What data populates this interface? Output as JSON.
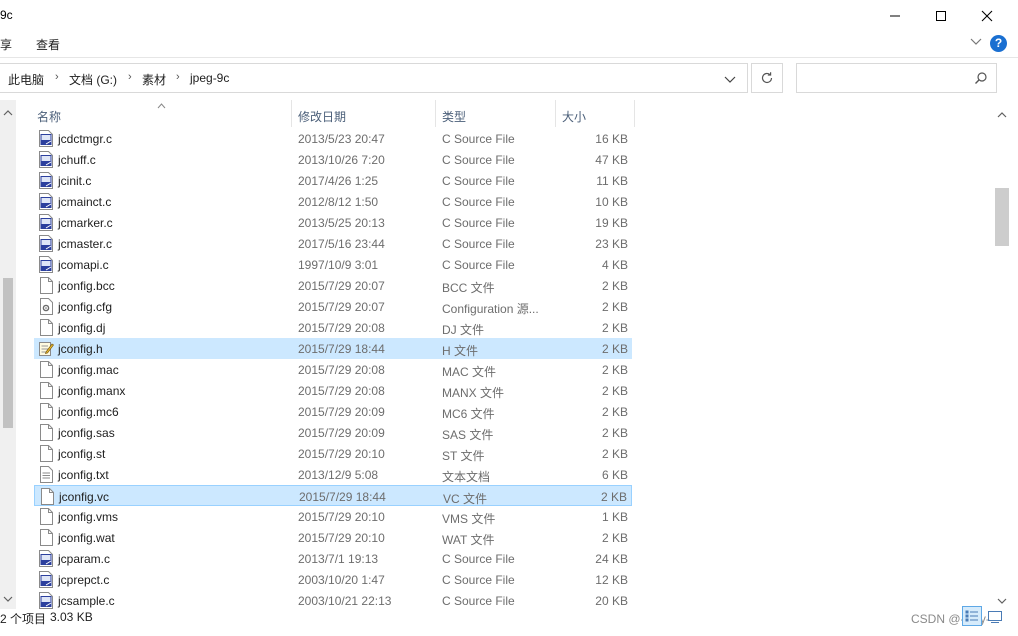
{
  "window": {
    "title": "9c"
  },
  "ribbon": {
    "tab_share": "享",
    "tab_view": "查看"
  },
  "address": {
    "crumbs": [
      "此电脑",
      "文档 (G:)",
      "素材",
      "jpeg-9c"
    ],
    "separator": "›"
  },
  "search": {
    "placeholder": ""
  },
  "columns": {
    "name": "名称",
    "date": "修改日期",
    "type": "类型",
    "size": "大小"
  },
  "files": [
    {
      "name": "jcdctmgr.c",
      "date": "2013/5/23 20:47",
      "type": "C Source File",
      "size": "16 KB",
      "icon": "c-source-file-icon",
      "state": ""
    },
    {
      "name": "jchuff.c",
      "date": "2013/10/26 7:20",
      "type": "C Source File",
      "size": "47 KB",
      "icon": "c-source-file-icon",
      "state": ""
    },
    {
      "name": "jcinit.c",
      "date": "2017/4/26 1:25",
      "type": "C Source File",
      "size": "11 KB",
      "icon": "c-source-file-icon",
      "state": ""
    },
    {
      "name": "jcmainct.c",
      "date": "2012/8/12 1:50",
      "type": "C Source File",
      "size": "10 KB",
      "icon": "c-source-file-icon",
      "state": ""
    },
    {
      "name": "jcmarker.c",
      "date": "2013/5/25 20:13",
      "type": "C Source File",
      "size": "19 KB",
      "icon": "c-source-file-icon",
      "state": ""
    },
    {
      "name": "jcmaster.c",
      "date": "2017/5/16 23:44",
      "type": "C Source File",
      "size": "23 KB",
      "icon": "c-source-file-icon",
      "state": ""
    },
    {
      "name": "jcomapi.c",
      "date": "1997/10/9 3:01",
      "type": "C Source File",
      "size": "4 KB",
      "icon": "c-source-file-icon",
      "state": ""
    },
    {
      "name": "jconfig.bcc",
      "date": "2015/7/29 20:07",
      "type": "BCC 文件",
      "size": "2 KB",
      "icon": "blank-file-icon",
      "state": ""
    },
    {
      "name": "jconfig.cfg",
      "date": "2015/7/29 20:07",
      "type": "Configuration 源...",
      "size": "2 KB",
      "icon": "config-file-icon",
      "state": ""
    },
    {
      "name": "jconfig.dj",
      "date": "2015/7/29 20:08",
      "type": "DJ 文件",
      "size": "2 KB",
      "icon": "blank-file-icon",
      "state": ""
    },
    {
      "name": "jconfig.h",
      "date": "2015/7/29 18:44",
      "type": "H 文件",
      "size": "2 KB",
      "icon": "header-file-icon",
      "state": "selected"
    },
    {
      "name": "jconfig.mac",
      "date": "2015/7/29 20:08",
      "type": "MAC 文件",
      "size": "2 KB",
      "icon": "blank-file-icon",
      "state": ""
    },
    {
      "name": "jconfig.manx",
      "date": "2015/7/29 20:08",
      "type": "MANX 文件",
      "size": "2 KB",
      "icon": "blank-file-icon",
      "state": ""
    },
    {
      "name": "jconfig.mc6",
      "date": "2015/7/29 20:09",
      "type": "MC6 文件",
      "size": "2 KB",
      "icon": "blank-file-icon",
      "state": ""
    },
    {
      "name": "jconfig.sas",
      "date": "2015/7/29 20:09",
      "type": "SAS 文件",
      "size": "2 KB",
      "icon": "blank-file-icon",
      "state": ""
    },
    {
      "name": "jconfig.st",
      "date": "2015/7/29 20:10",
      "type": "ST 文件",
      "size": "2 KB",
      "icon": "blank-file-icon",
      "state": ""
    },
    {
      "name": "jconfig.txt",
      "date": "2013/12/9 5:08",
      "type": "文本文档",
      "size": "6 KB",
      "icon": "text-file-icon",
      "state": ""
    },
    {
      "name": "jconfig.vc",
      "date": "2015/7/29 18:44",
      "type": "VC 文件",
      "size": "2 KB",
      "icon": "blank-file-icon",
      "state": "focused"
    },
    {
      "name": "jconfig.vms",
      "date": "2015/7/29 20:10",
      "type": "VMS 文件",
      "size": "1 KB",
      "icon": "blank-file-icon",
      "state": ""
    },
    {
      "name": "jconfig.wat",
      "date": "2015/7/29 20:10",
      "type": "WAT 文件",
      "size": "2 KB",
      "icon": "blank-file-icon",
      "state": ""
    },
    {
      "name": "jcparam.c",
      "date": "2013/7/1 19:13",
      "type": "C Source File",
      "size": "24 KB",
      "icon": "c-source-file-icon",
      "state": ""
    },
    {
      "name": "jcprepct.c",
      "date": "2003/10/20 1:47",
      "type": "C Source File",
      "size": "12 KB",
      "icon": "c-source-file-icon",
      "state": ""
    },
    {
      "name": "jcsample.c",
      "date": "2003/10/21 22:13",
      "type": "C Source File",
      "size": "20 KB",
      "icon": "c-source-file-icon",
      "state": ""
    }
  ],
  "status": {
    "item_count": "2 个项目",
    "selected_size": "3.03 KB"
  },
  "watermark": "CSDN @-Lwy-",
  "colors": {
    "selection": "#cce8ff",
    "selection_border": "#99d1ff",
    "header_text": "#4c607a",
    "c_icon_blue": "#2b3f9e"
  }
}
